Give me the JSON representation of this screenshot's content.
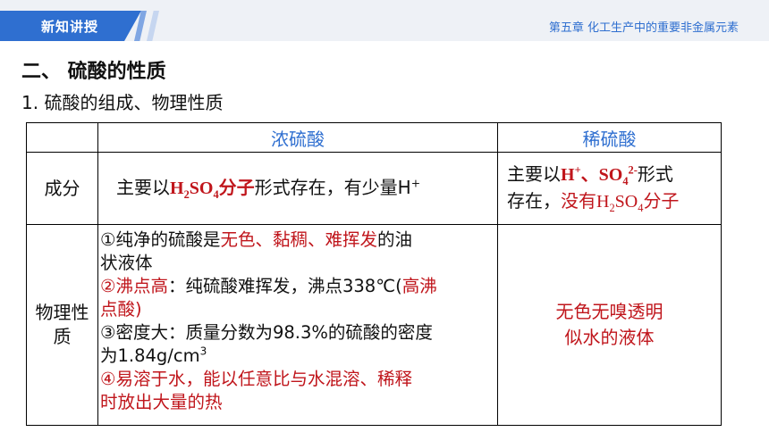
{
  "header": {
    "tab_label": "新知讲授",
    "chapter": "第五章  化工生产中的重要非金属元素"
  },
  "section": {
    "title": "二、 硫酸的性质",
    "subtitle": "1. 硫酸的组成、物理性质"
  },
  "table": {
    "col_concentrated": "浓硫酸",
    "col_dilute": "稀硫酸",
    "row_composition": "成分",
    "row_physical_line1": "物理性",
    "row_physical_line2": "质",
    "comp_conc": {
      "pre": "主要以",
      "h": "H",
      "two": "2",
      "so": "SO",
      "four": "4",
      "mol": "分子",
      "post": "形式存在，有少量H",
      "plus": "+"
    },
    "comp_dil": {
      "pre": "主要以",
      "h": "H",
      "plus": "+",
      "sep": "、",
      "so": "SO",
      "four": "4",
      "charge": "2-",
      "post1": "形式",
      "line2_pre": "存在，",
      "none": "没有",
      "h2": "H",
      "two": "2",
      "so2": "SO",
      "four2": "4",
      "mol": "分子"
    },
    "phys_conc": {
      "l1_pre": "①纯净的硫酸是",
      "l1_red": "无色、黏稠、难挥发",
      "l1_post": "的油",
      "l2": "状液体",
      "l3_red1": "②沸点高",
      "l3_mid": "：纯硫酸难挥发，沸点338℃(",
      "l3_red2": "高沸",
      "l4_red": "点酸)",
      "l5_pre": "③密度大：质量分数为98.3%的硫酸的密度",
      "l6_pre": "为1.84g/cm",
      "l6_sup": "3",
      "l7_red": "④易溶于水，能以任意比与水混溶、稀释",
      "l8_red": "时放出大量的热"
    },
    "phys_dil_line1": "无色无嗅透明",
    "phys_dil_line2": "似水的液体"
  },
  "colors": {
    "accent_blue": "#2f6fd0",
    "highlight_red": "#c0161c",
    "header_bg": "#eef1f6"
  }
}
